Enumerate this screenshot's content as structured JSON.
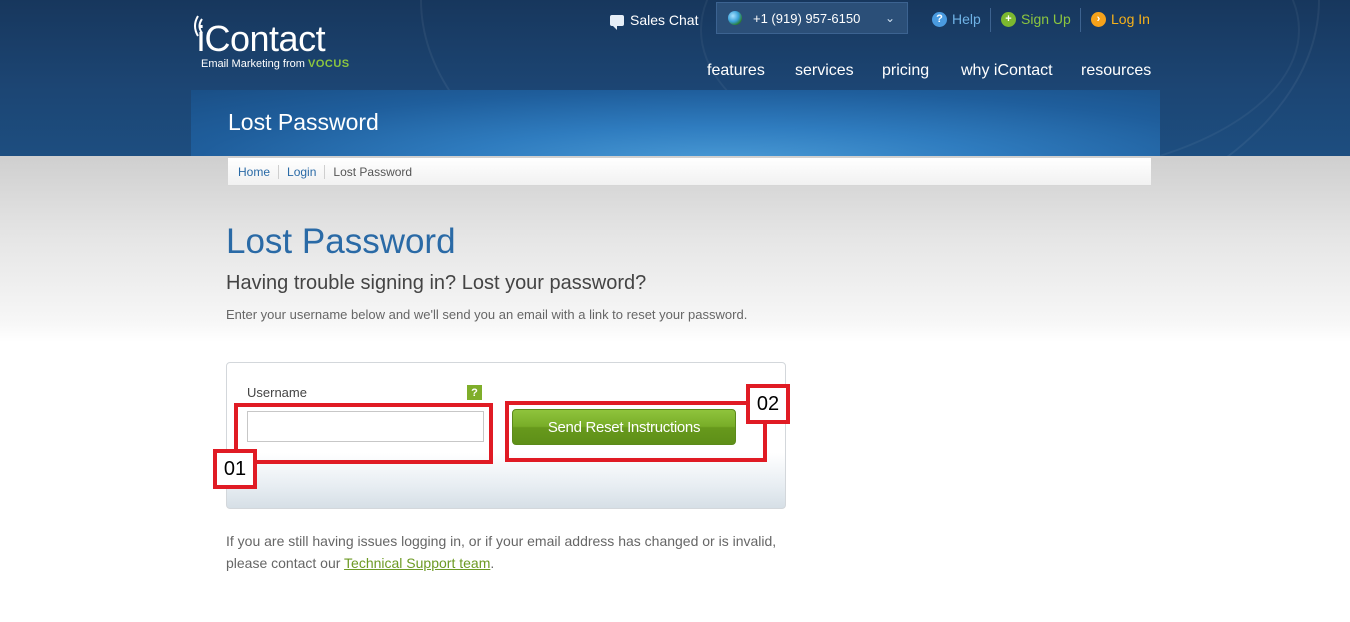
{
  "header": {
    "logo_text": "iContact",
    "logo_tagline_prefix": "Email Marketing from",
    "logo_tagline_brand": "VOCUS",
    "sales_chat_label": "Sales Chat",
    "phone_number": "+1 (919) 957-6150",
    "help_label": "Help",
    "signup_label": "Sign Up",
    "login_label": "Log In",
    "nav": [
      {
        "label": "features"
      },
      {
        "label": "services"
      },
      {
        "label": "pricing"
      },
      {
        "label": "why iContact"
      },
      {
        "label": "resources"
      }
    ],
    "page_banner_title": "Lost Password"
  },
  "breadcrumb": [
    {
      "label": "Home"
    },
    {
      "label": "Login"
    },
    {
      "label": "Lost Password"
    }
  ],
  "main": {
    "title": "Lost Password",
    "subtitle": "Having trouble signing in? Lost your password?",
    "instructions": "Enter your username below and we'll send you an email with a link to reset your password.",
    "form": {
      "username_label": "Username",
      "help_badge": "?",
      "username_value": "",
      "submit_label": "Send Reset Instructions"
    },
    "support_text_before": "If you are still having issues logging in, or if your email address has changed or is invalid, please contact our ",
    "support_link_label": "Technical Support team",
    "support_text_after": "."
  },
  "annotations": [
    {
      "label": "01"
    },
    {
      "label": "02"
    }
  ],
  "colors": {
    "header_navy": "#1c4573",
    "title_blue": "#2a6aa6",
    "button_green": "#78ad28",
    "annotation_red": "#e01b24",
    "login_orange": "#f6b11a",
    "signup_green": "#8cc63f"
  },
  "icons": {
    "sales_chat": "chat-bubble-icon",
    "phone": "globe-icon",
    "phone_dropdown": "chevron-down-icon",
    "help": "question-circle-icon",
    "signup": "plus-circle-icon",
    "login": "arrow-circle-icon"
  }
}
